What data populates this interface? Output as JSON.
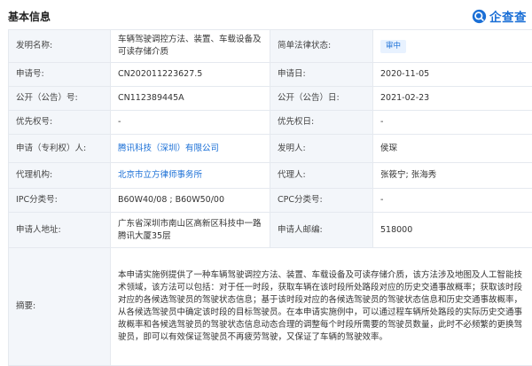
{
  "header": {
    "title": "基本信息",
    "logo_text": "企查查"
  },
  "colors": {
    "accent": "#1a6fd6",
    "label_bg": "#f3f6fa",
    "border": "#e5e9ef",
    "badge_bg": "#e8f2ff"
  },
  "rows": {
    "invention_name": {
      "label": "发明名称:",
      "value": "车辆驾驶调控方法、装置、车载设备及可读存储介质"
    },
    "legal_status": {
      "label": "简单法律状态:",
      "value": "审中"
    },
    "app_no": {
      "label": "申请号:",
      "value": "CN202011223627.5"
    },
    "app_date": {
      "label": "申请日:",
      "value": "2020-11-05"
    },
    "pub_no": {
      "label": "公开（公告）号:",
      "value": "CN112389445A"
    },
    "pub_date": {
      "label": "公开（公告）日:",
      "value": "2021-02-23"
    },
    "priority_no": {
      "label": "优先权号:",
      "value": "-"
    },
    "priority_date": {
      "label": "优先权日:",
      "value": "-"
    },
    "applicant": {
      "label": "申请（专利权）人:",
      "value": "腾讯科技（深圳）有限公司"
    },
    "inventor": {
      "label": "发明人:",
      "value": "侯琛"
    },
    "agency": {
      "label": "代理机构:",
      "value": "北京市立方律师事务所"
    },
    "agent": {
      "label": "代理人:",
      "value": "张筱宁; 张海秀"
    },
    "ipc": {
      "label": "IPC分类号:",
      "value": "B60W40/08 ; B60W50/00"
    },
    "cpc": {
      "label": "CPC分类号:",
      "value": "-"
    },
    "address": {
      "label": "申请人地址:",
      "value": "广东省深圳市南山区高新区科技中一路腾讯大厦35层"
    },
    "postcode": {
      "label": "申请人邮编:",
      "value": "518000"
    },
    "abstract": {
      "label": "摘要:",
      "value": "本申请实施例提供了一种车辆驾驶调控方法、装置、车载设备及可读存储介质，该方法涉及地图及人工智能技术领域，该方法可以包括：对于任一时段，获取车辆在该时段所处路段对应的历史交通事故概率；获取该时段对应的各候选驾驶员的驾驶状态信息；基于该时段对应的各候选驾驶员的驾驶状态信息和历史交通事故概率，从各候选驾驶员中确定该时段的目标驾驶员。在本申请实施例中，可以通过程车辆所处路段的实际历史交通事故概率和各候选驾驶员的驾驶状态信息动态合理的调整每个时段所需要的驾驶员数量，此时不必频繁的更换驾驶员，即可以有效保证驾驶员不再疲劳驾驶，又保证了车辆的驾驶效率。"
    }
  }
}
